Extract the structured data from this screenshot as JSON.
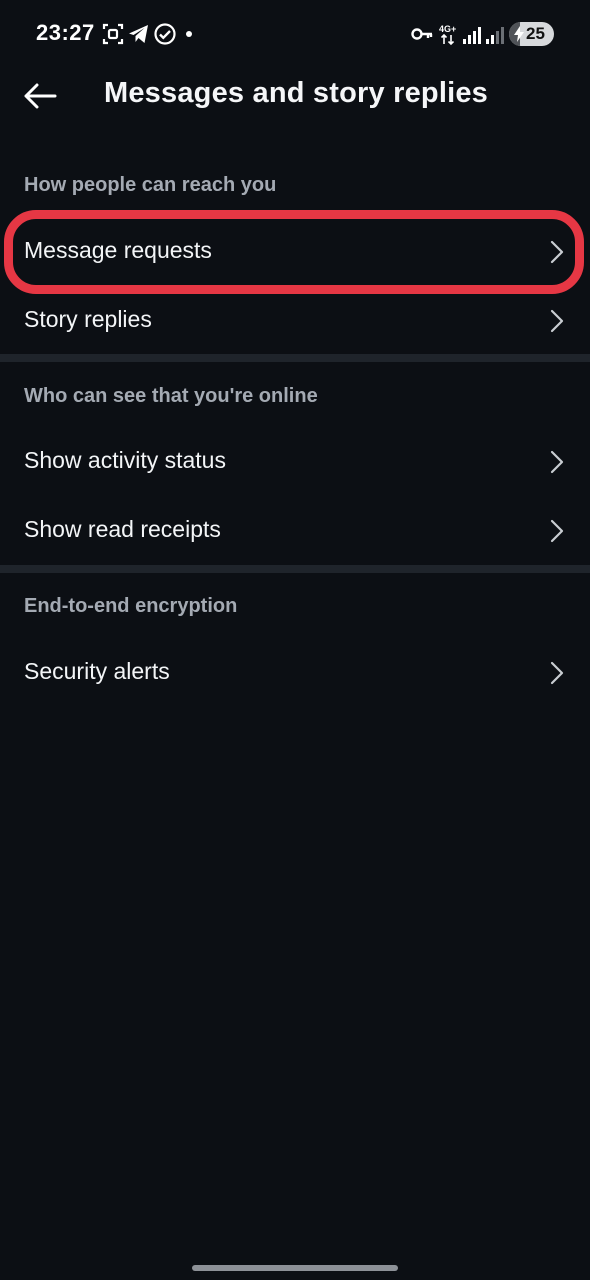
{
  "status_bar": {
    "time": "23:27",
    "icons": [
      "screenshot-icon",
      "telegram-icon",
      "check-circle-icon",
      "dot-icon",
      "vpn-key-icon",
      "network-4g-icon",
      "signal-icon",
      "signal-2-icon"
    ],
    "network_label": "4G+",
    "battery_level": "25",
    "battery_fraction": 0.25
  },
  "header": {
    "back_icon": "arrow-left-icon",
    "title": "Messages and story replies"
  },
  "sections": [
    {
      "heading": "How people can reach you",
      "items": [
        {
          "label": "Message requests",
          "highlighted": true
        },
        {
          "label": "Story replies"
        }
      ]
    },
    {
      "heading": "Who can see that you're online",
      "items": [
        {
          "label": "Show activity status"
        },
        {
          "label": "Show read receipts"
        }
      ]
    },
    {
      "heading": "End-to-end encryption",
      "items": [
        {
          "label": "Security alerts"
        }
      ]
    }
  ],
  "colors": {
    "background": "#0c0f14",
    "divider": "#1f242b",
    "heading_text": "#a4aab3",
    "row_text": "#f3f5f7",
    "highlight": "#e63744"
  }
}
